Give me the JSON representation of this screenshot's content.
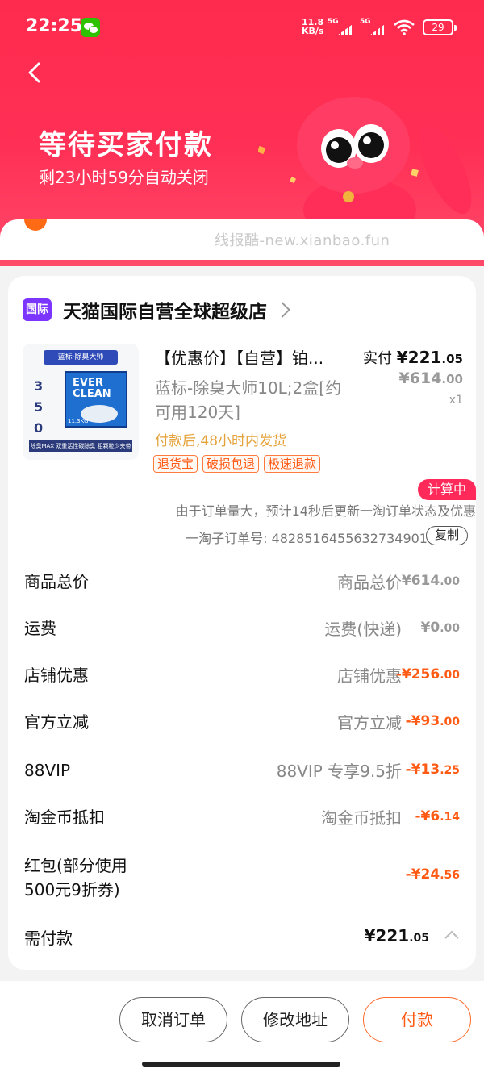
{
  "status_bar": {
    "time": "22:25",
    "net_speed": "11.8 KB/s",
    "sim1": "5G",
    "sim2": "5G",
    "battery": "29"
  },
  "header": {
    "title": "等待买家付款",
    "subtitle": "剩23小时59分自动关闭"
  },
  "watermark": "线报酷-new.xianbao.fun",
  "shop": {
    "badge": "国际",
    "name": "天猫国际自营全球超级店"
  },
  "product": {
    "title": "【优惠价】【自营】铂...",
    "spec": "蓝标-除臭大师10L;2盒[约可用120天]",
    "shipping": "付款后,48小时内发货",
    "tags": [
      "退货宝",
      "破损包退",
      "极速退款"
    ],
    "paid_label": "实付",
    "paid_price_int": "¥221",
    "paid_price_dec": ".05",
    "original_price_int": "¥614",
    "original_price_dec": ".00",
    "quantity": "x1",
    "image": {
      "header_text": "蓝标·除臭大师",
      "brand": "EVER CLEAN",
      "nums": "3\n5\n0",
      "footer_text": "除臭MAX 双重活性碳除臭 粗颗粒少夹带",
      "weight": "11.3KG"
    }
  },
  "order": {
    "calc_badge": "计算中",
    "notice": "由于订单量大，预计14秒后更新一淘订单状态及优惠",
    "sub_order_label": "一淘子订单号: 4828516455632734901",
    "copy_label": "复制"
  },
  "fees": [
    {
      "name": "商品总价",
      "desc": "商品总价",
      "amt_int": "¥614",
      "amt_dec": ".00",
      "negative": false
    },
    {
      "name": "运费",
      "desc": "运费(快递)",
      "amt_int": "¥0",
      "amt_dec": ".00",
      "negative": false
    },
    {
      "name": "店铺优惠",
      "desc": "店铺优惠",
      "amt_int": "-¥256",
      "amt_dec": ".00",
      "negative": true
    },
    {
      "name": "官方立减",
      "desc": "官方立减",
      "amt_int": "-¥93",
      "amt_dec": ".00",
      "negative": true
    },
    {
      "name": "88VIP",
      "desc": "88VIP 专享9.5折",
      "amt_int": "-¥13",
      "amt_dec": ".25",
      "negative": true
    },
    {
      "name": "淘金币抵扣",
      "desc": "淘金币抵扣",
      "amt_int": "-¥6",
      "amt_dec": ".14",
      "negative": true
    },
    {
      "name": "红包(部分使用500元9折券)",
      "desc": "",
      "amt_int": "-¥24",
      "amt_dec": ".56",
      "negative": true
    }
  ],
  "total": {
    "label": "需付款",
    "amt_int": "¥221",
    "amt_dec": ".05"
  },
  "actions": {
    "cancel": "取消订单",
    "edit_address": "修改地址",
    "pay": "付款"
  },
  "colors": {
    "header_red": "#ff2b4e",
    "accent_orange": "#ff5a14",
    "shop_purple": "#7b35ff"
  }
}
